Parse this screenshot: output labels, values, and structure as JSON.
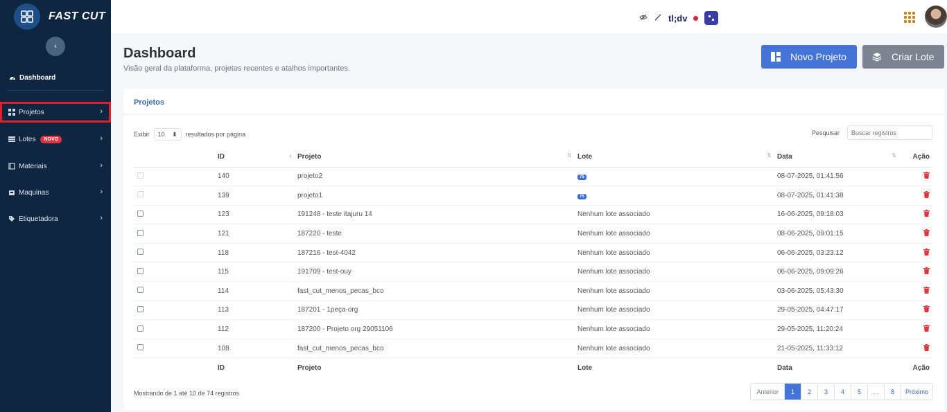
{
  "sidebar": {
    "brand": "FAST CUT",
    "collapse_glyph": "‹",
    "dashboard_label": "Dashboard",
    "items": [
      {
        "label": "Projetos",
        "icon": "grid-icon",
        "highlighted": true
      },
      {
        "label": "Lotes",
        "icon": "layers-icon",
        "badge": "NOVO"
      },
      {
        "label": "Materiais",
        "icon": "box-icon"
      },
      {
        "label": "Maquinas",
        "icon": "machine-icon"
      },
      {
        "label": "Etiquetadora",
        "icon": "tag-icon"
      }
    ]
  },
  "topbar": {
    "tldv": "tl;dv"
  },
  "header": {
    "title": "Dashboard",
    "subtitle": "Visão geral da plataforma, projetos recentes e atalhos importantes.",
    "primary_button": "Novo Projeto",
    "secondary_button": "Criar Lote"
  },
  "card": {
    "title": "Projetos",
    "length_prefix": "Exibir",
    "length_value": "10",
    "length_suffix": "resultados por página",
    "search_label": "Pesquisar",
    "search_placeholder": "Buscar registros"
  },
  "table": {
    "columns": {
      "id": "ID",
      "projeto": "Projeto",
      "lote": "Lote",
      "data": "Data",
      "acao": "Ação"
    },
    "rows": [
      {
        "id": "140",
        "projeto": "projeto2",
        "lote": "75",
        "lote_badge": true,
        "data": "08-07-2025, 01:41:56",
        "disabled": true
      },
      {
        "id": "139",
        "projeto": "projeto1",
        "lote": "75",
        "lote_badge": true,
        "data": "08-07-2025, 01:41:38",
        "disabled": true
      },
      {
        "id": "123",
        "projeto": "191248 - teste itajuru 14",
        "lote": "Nenhum lote associado",
        "data": "16-06-2025, 09:18:03"
      },
      {
        "id": "121",
        "projeto": "187220 - teste",
        "lote": "Nenhum lote associado",
        "data": "08-06-2025, 09:01:15"
      },
      {
        "id": "118",
        "projeto": "187216 - test-4042",
        "lote": "Nenhum lote associado",
        "data": "06-06-2025, 03:23:12"
      },
      {
        "id": "115",
        "projeto": "191709 - test-ouy",
        "lote": "Nenhum lote associado",
        "data": "06-06-2025, 09:09:26"
      },
      {
        "id": "114",
        "projeto": "fast_cut_menos_pecas_bco",
        "lote": "Nenhum lote associado",
        "data": "03-06-2025, 05:43:30"
      },
      {
        "id": "113",
        "projeto": "187201 - 1peça-org",
        "lote": "Nenhum lote associado",
        "data": "29-05-2025, 04:47:17"
      },
      {
        "id": "112",
        "projeto": "187200 - Projeto org 29051106",
        "lote": "Nenhum lote associado",
        "data": "29-05-2025, 11:20:24"
      },
      {
        "id": "108",
        "projeto": "fast_cut_menos_pecas_bco",
        "lote": "Nenhum lote associado",
        "data": "21-05-2025, 11:33:12"
      }
    ]
  },
  "footer": {
    "info": "Mostrando de 1 até 10 de 74 registros",
    "pagination": {
      "prev": "Anterior",
      "pages": [
        "1",
        "2",
        "3",
        "4",
        "5",
        "…",
        "8"
      ],
      "active": "1",
      "next": "Próximo"
    }
  },
  "colors": {
    "sidebar_bg": "#0e2640",
    "primary": "#4475d6",
    "secondary": "#7b8490",
    "danger": "#e0343f",
    "highlight_outline": "#e0212d"
  }
}
